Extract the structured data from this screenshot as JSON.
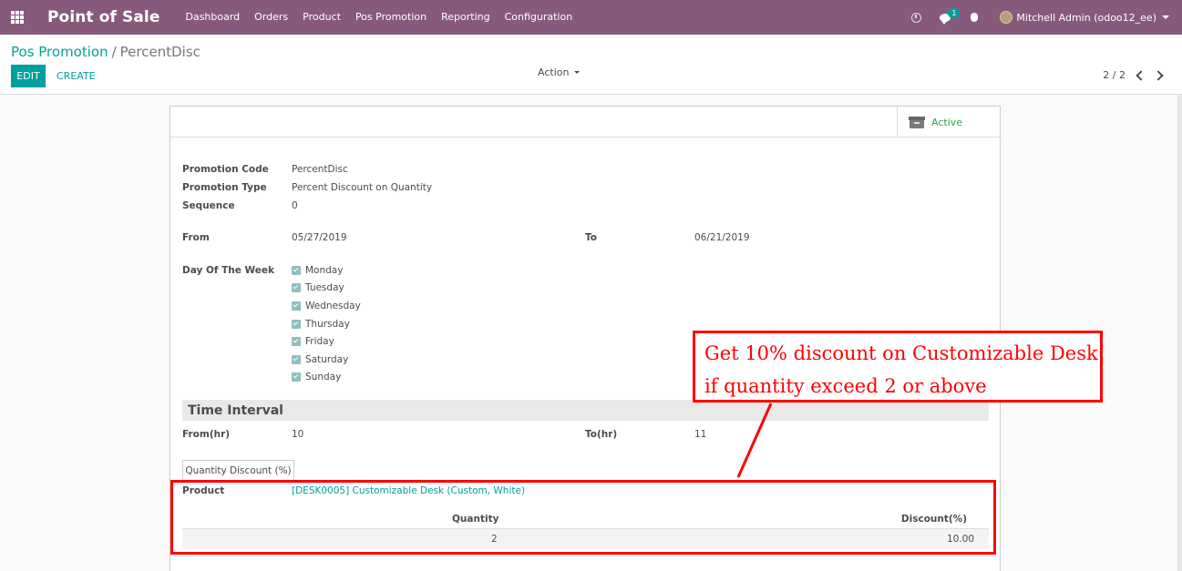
{
  "navbar": {
    "brand": "Point of Sale",
    "menu": [
      "Dashboard",
      "Orders",
      "Product",
      "Pos Promotion",
      "Reporting",
      "Configuration"
    ],
    "notification_count": "1",
    "user": "Mitchell Admin (odoo12_ee)",
    "icons": [
      "apps-icon",
      "clock-icon",
      "chat-icon",
      "bug-icon",
      "avatar"
    ]
  },
  "control": {
    "breadcrumb_parent": "Pos Promotion",
    "breadcrumb_sep": "/",
    "breadcrumb_current": "PercentDisc",
    "edit_label": "EDIT",
    "create_label": "CREATE",
    "action_label": "Action",
    "pager": "2 / 2"
  },
  "form": {
    "active_label": "Active",
    "fields": {
      "promotion_code": {
        "label": "Promotion Code",
        "value": "PercentDisc"
      },
      "promotion_type": {
        "label": "Promotion Type",
        "value": "Percent Discount on Quantity"
      },
      "sequence": {
        "label": "Sequence",
        "value": "0"
      },
      "from": {
        "label": "From",
        "value": "05/27/2019"
      },
      "to": {
        "label": "To",
        "value": "06/21/2019"
      }
    },
    "day_of_week_label": "Day Of The Week",
    "days": [
      "Monday",
      "Tuesday",
      "Wednesday",
      "Thursday",
      "Friday",
      "Saturday",
      "Sunday"
    ],
    "time_interval": {
      "title": "Time Interval",
      "from_label": "From(hr)",
      "from_value": "10",
      "to_label": "To(hr)",
      "to_value": "11"
    },
    "tab": "Quantity Discount (%)",
    "product_label": "Product",
    "product_value": "[DESK0005] Customizable Desk (Custom, White)",
    "table": {
      "headers": [
        "Quantity",
        "Discount(%)"
      ],
      "rows": [
        [
          "2",
          "10.00"
        ]
      ]
    }
  },
  "annotation": {
    "line1": "Get 10% discount on Customizable Desk",
    "line2": "if quantity exceed 2 or above",
    "color": "#ff0000"
  },
  "colors": {
    "navbar": "#875a7b",
    "accent": "#00a09d",
    "active": "#28a745"
  }
}
